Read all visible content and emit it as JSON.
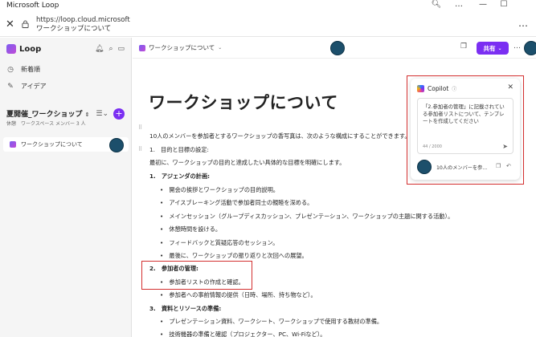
{
  "window": {
    "title": "Microsoft Loop",
    "zoom_icon": "zoom-icon",
    "more": "…",
    "minimize": "—",
    "maximize": "☐"
  },
  "address": {
    "url": "https://loop.cloud.microsoft",
    "page_title": "ワークショップについて",
    "more": "…"
  },
  "sidebar": {
    "app_name": "Loop",
    "nav": [
      {
        "label": "新着順",
        "icon": "clock-icon"
      },
      {
        "label": "アイデア",
        "icon": "pen-icon"
      }
    ],
    "workspace": {
      "title": "夏開催_ワークショップ",
      "subtitle": "休憩　ワークスペース メンバー 3 人"
    },
    "pages": [
      {
        "label": "ワークショップについて"
      }
    ]
  },
  "toolbar": {
    "breadcrumb": "ワークショップについて",
    "share_label": "共有",
    "more": "…"
  },
  "document": {
    "title": "ワークショップについて",
    "intro": "10人のメンバーを参加者とするワークショップの香写真は、次のような構成にすることができます。",
    "lines": [
      {
        "text": "1.　目的と目標の設定:",
        "bold": false
      },
      {
        "text": "最初に、ワークショップの目的と達成したい具体的な目標を明確にします。",
        "bold": false
      },
      {
        "text": "1.　アジェンダの計画:",
        "bold": true
      },
      {
        "text": "•　開会の挨拶とワークショップの目的説明。",
        "bold": false
      },
      {
        "text": "•　アイスブレーキング活動で参加者同士の親睦を深める。",
        "bold": false
      },
      {
        "text": "•　メインセッション（グループディスカッション、プレゼンテーション、ワークショップの主題に関する活動）。",
        "bold": false
      },
      {
        "text": "•　休憩時間を設ける。",
        "bold": false
      },
      {
        "text": "•　フィードバックと質疑応答のセッション。",
        "bold": false
      },
      {
        "text": "•　最後に、ワークショップの振り返りと次回への展望。",
        "bold": false
      },
      {
        "text": "2.　参加者の管理:",
        "bold": true
      },
      {
        "text": "•　参加者リストの作成と確認。",
        "bold": false
      },
      {
        "text": "•　参加者への事前情報の提供（日時、場所、持ち物など）。",
        "bold": false
      },
      {
        "text": "3.　資料とリソースの準備:",
        "bold": true
      },
      {
        "text": "•　プレゼンテーション資料、ワークシート、ワークショップで使用する教材の準備。",
        "bold": false
      },
      {
        "text": "•　技術機器の準備と確認（プロジェクター、PC、Wi-Fiなど）。",
        "bold": false
      }
    ]
  },
  "copilot": {
    "title": "Copilot",
    "prompt": "「2.参加者の管理」に記載されている参加者リストについて、テンプレートを作成してください",
    "char_count": "44 / 2000",
    "context_chip": "10人のメンバーを参..."
  }
}
